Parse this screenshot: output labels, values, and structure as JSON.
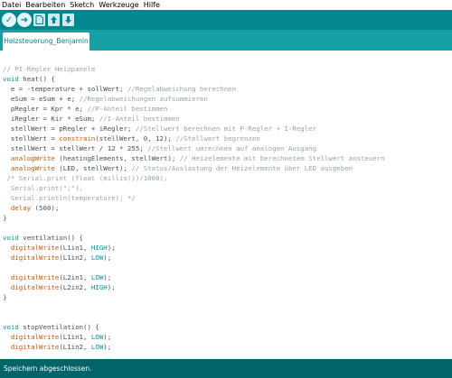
{
  "menu": {
    "items": [
      "Datei",
      "Bearbeiten",
      "Sketch",
      "Werkzeuge",
      "Hilfe"
    ]
  },
  "toolbar": {
    "verify_icon": "check-icon",
    "upload_icon": "arrow-right-icon",
    "new_icon": "new-file-icon",
    "open_icon": "open-icon",
    "save_icon": "save-icon"
  },
  "tabs": [
    {
      "label": "Heizsteuerung_Benjamin"
    }
  ],
  "editor": {
    "lines": [
      "",
      "// PI-Regler Heizpanele",
      "void heat() {",
      "  e = -temperature + sollWert; //Regelabweichung berechnen",
      "  eSum = eSum + e; //Regelabweichungen aufsummieren",
      "  pRegler = Kpr * e; //P-Anteil bestimmen",
      "  iRegler = Kir * eSum; //I-Anteil bestimmen",
      "  stellWert = pRegler + iRegler; //Stellwert berechnen mit P-Regler + I-Regler",
      "  stellWert = constrain(stellWert, 0, 12); //Stellwert begrenzen",
      "  stellWert = stellWert / 12 * 255; //Stellwert umrechnen auf analogen Ausgang",
      "  analogWrite (heatingElements, stellWert); // Heizelemente mit berechnetem Stellwert ansteuern",
      "  analogWrite (LED, stellWert); // Status/Auslastung der Heizelemente über LED ausgeben",
      " /* Serial.print (float (millis())/1000);",
      "  Serial.print(\";\");",
      "  Serial.println(temperature); */",
      "  delay (500);",
      "}",
      "",
      "void ventilation() {",
      "  digitalWrite(L1in1, HIGH);",
      "  digitalWrite(L1in2, LOW);",
      "",
      "  digitalWrite(L2in1, LOW);",
      "  digitalWrite(L2in2, HIGH);",
      "}",
      "",
      "",
      "void stopVentilation() {",
      "  digitalWrite(L1in1, LOW);",
      "  digitalWrite(L1in2, LOW);"
    ]
  },
  "status": {
    "message": "Speichern abgeschlossen."
  },
  "colors": {
    "toolbar": "#00878f",
    "tabbar": "#17a1a5",
    "statusbar": "#006468",
    "keyword": "#00979c",
    "function": "#d35400",
    "comment": "#95a5a6"
  }
}
